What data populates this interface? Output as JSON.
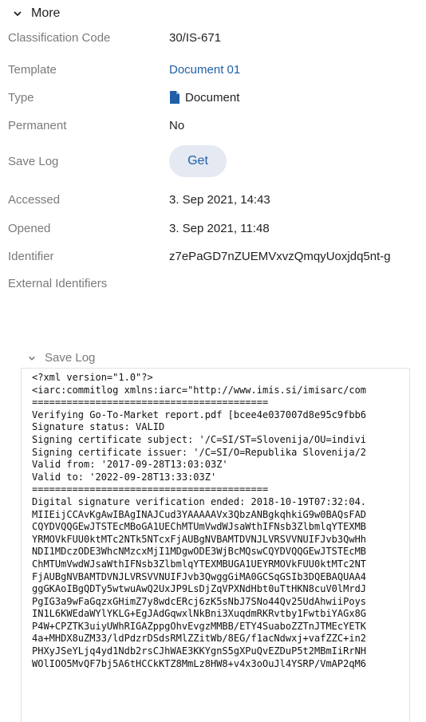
{
  "more": {
    "label": "More"
  },
  "properties": {
    "classification_code": {
      "label": "Classification Code",
      "value": "30/IS-671"
    },
    "template": {
      "label": "Template",
      "value": "Document 01"
    },
    "type": {
      "label": "Type",
      "value": "Document"
    },
    "permanent": {
      "label": "Permanent",
      "value": "No"
    },
    "save_log": {
      "label": "Save Log",
      "button": "Get"
    },
    "accessed": {
      "label": "Accessed",
      "value": "3. Sep 2021, 14:43"
    },
    "opened": {
      "label": "Opened",
      "value": "3. Sep 2021, 11:48"
    },
    "identifier": {
      "label": "Identifier",
      "value": "z7ePaGD7nZUEMVxvzQmqyUoxjdq5nt-g"
    },
    "external_identifiers": {
      "label": "External Identifiers"
    }
  },
  "save_log_section": {
    "label": "Save Log",
    "lines": [
      "<?xml version=\"1.0\"?>",
      "<iarc:commitlog xmlns:iarc=\"http://www.imis.si/imisarc/com",
      "=========================================",
      "Verifying Go-To-Market report.pdf [bcee4e037007d8e95c9fbb6",
      "Signature status: VALID",
      "Signing certificate subject: '/C=SI/ST=Slovenija/OU=indivi",
      "Signing certificate issuer: '/C=SI/O=Republika Slovenija/2",
      "Valid from: '2017-09-28T13:03:03Z'",
      "Valid to: '2022-09-28T13:33:03Z'",
      "=========================================",
      "Digital signature verification ended: 2018-10-19T07:32:04.",
      "MIIEijCCAvKgAwIBAgINAJCud3YAAAAAVx3QbzANBgkqhkiG9w0BAQsFAD",
      "CQYDVQQGEwJTSTEcMBoGA1UEChMTUmVwdWJsaWthIFNsb3ZlbmlqYTEXMB",
      "YRMOVkFUU0ktMTc2NTk5NTcxFjAUBgNVBAMTDVNJLVRSVVNUIFJvb3QwHh",
      "NDI1MDczODE3WhcNMzcxMjI1MDgwODE3WjBcMQswCQYDVQQGEwJTSTEcMB",
      "ChMTUmVwdWJsaWthIFNsb3ZlbmlqYTEXMBUGA1UEYRMOVkFUU0ktMTc2NT",
      "FjAUBgNVBAMTDVNJLVRSVVNUIFJvb3QwggGiMA0GCSqGSIb3DQEBAQUAA4",
      "ggGKAoIBgQDTy5wtwuAwQ2UxJP9LsDjZqVPXNdHbt0uTtHKN8cuV0lMrdJ",
      "PgIG3a9wFaGqzxGHimZ7y8wdcERcj6zK5sNbJ7SNo44Qv25UdAhwiiPoys",
      "IN1L6KWEdaWYlYKLG+EgJAdGqwxlNkBni3XuqdmRKRvtby1FwtbiYAGx8G",
      "P4W+CPZTK3uiyUWhRIGAZppgOhvEvgzMMBB/ETY4SuaboZZTnJTMEcYETK",
      "4a+MHDX8uZM33/ldPdzrDSdsRMlZZitWb/8EG/f1acNdwxj+vafZZC+in2",
      "PHXyJSeYLjq4yd1Ndb2rsCJhWAE3KKYgnS5gXPuQvEZDuP5t2MBmIiRrNH",
      "WOlIOO5MvQF7bj5A6tHCCkKTZ8MmLz8HW8+v4x3oOuJl4YSRP/VmAP2qM6"
    ]
  },
  "colors": {
    "link": "#1f5fa8",
    "label": "#7a7a7a",
    "button_bg": "#e4e9f2",
    "doc_icon": "#1f5fa8"
  }
}
